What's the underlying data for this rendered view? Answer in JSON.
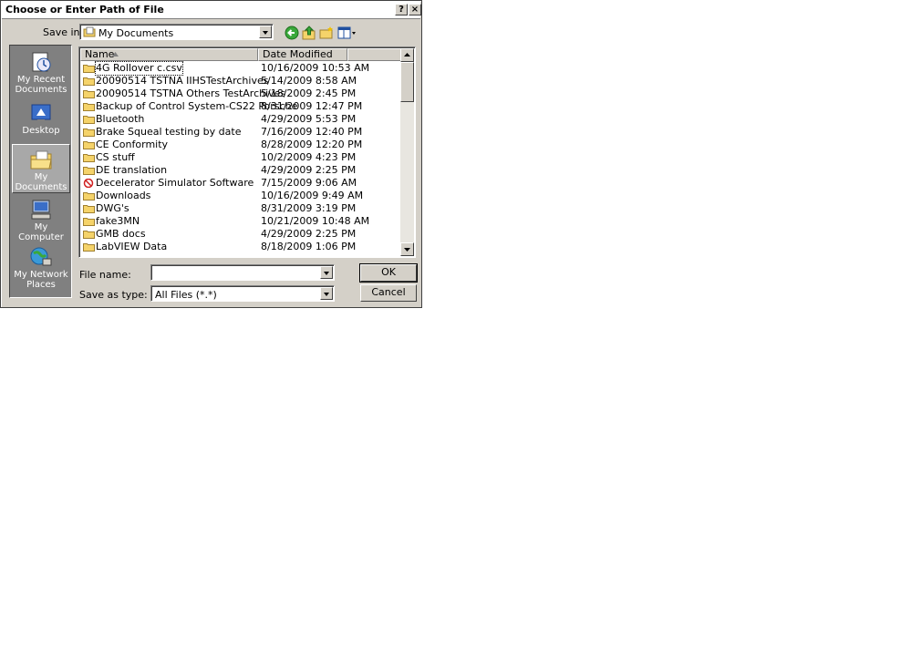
{
  "dialog": {
    "title": "Choose or Enter Path of File",
    "help_label": "?",
    "close_label": "×"
  },
  "toolbar": {
    "save_in_label": "Save in:",
    "save_in_value": "My Documents",
    "icons": [
      "back-icon",
      "up-folder-icon",
      "new-folder-icon",
      "views-menu-icon"
    ]
  },
  "places": [
    {
      "label": "My Recent Documents"
    },
    {
      "label": "Desktop"
    },
    {
      "label": "My Documents",
      "selected": true
    },
    {
      "label": "My Computer"
    },
    {
      "label": "My Network Places"
    }
  ],
  "list": {
    "columns": [
      "Name",
      "Date Modified"
    ],
    "rows": [
      {
        "name": "4G Rollover c.csv",
        "date": "10/16/2009 10:53 AM"
      },
      {
        "name": "20090514 TSTNA IIHSTestArchives",
        "date": "5/14/2009 8:58 AM"
      },
      {
        "name": "20090514 TSTNA Others TestArchives",
        "date": "5/18/2009 2:45 PM"
      },
      {
        "name": "Backup of Control System-CS22 Porsche",
        "date": "8/31/2009 12:47 PM"
      },
      {
        "name": "Bluetooth",
        "date": "4/29/2009 5:53 PM"
      },
      {
        "name": "Brake Squeal testing by date",
        "date": "7/16/2009 12:40 PM"
      },
      {
        "name": "CE Conformity",
        "date": "8/28/2009 12:20 PM"
      },
      {
        "name": "CS stuff",
        "date": "10/2/2009 4:23 PM"
      },
      {
        "name": "DE translation",
        "date": "4/29/2009 2:25 PM"
      },
      {
        "name": "Decelerator Simulator Software",
        "date": "7/15/2009 9:06 AM"
      },
      {
        "name": "Downloads",
        "date": "10/16/2009 9:49 AM"
      },
      {
        "name": "DWG's",
        "date": "8/31/2009 3:19 PM"
      },
      {
        "name": "fake3MN",
        "date": "10/21/2009 10:48 AM"
      },
      {
        "name": "GMB docs",
        "date": "4/29/2009 2:25 PM"
      },
      {
        "name": "LabVIEW Data",
        "date": "8/18/2009 1:06 PM"
      }
    ]
  },
  "form": {
    "file_name_label": "File name:",
    "file_name_value": "",
    "save_as_type_label": "Save as type:",
    "save_as_type_value": "All Files (*.*)",
    "ok_label": "OK",
    "cancel_label": "Cancel"
  },
  "colors": {
    "dialog_face": "#d4d0c8",
    "places_bg": "#808080",
    "folder_yellow": "#f5d36a",
    "blocked_red": "#d02020"
  }
}
